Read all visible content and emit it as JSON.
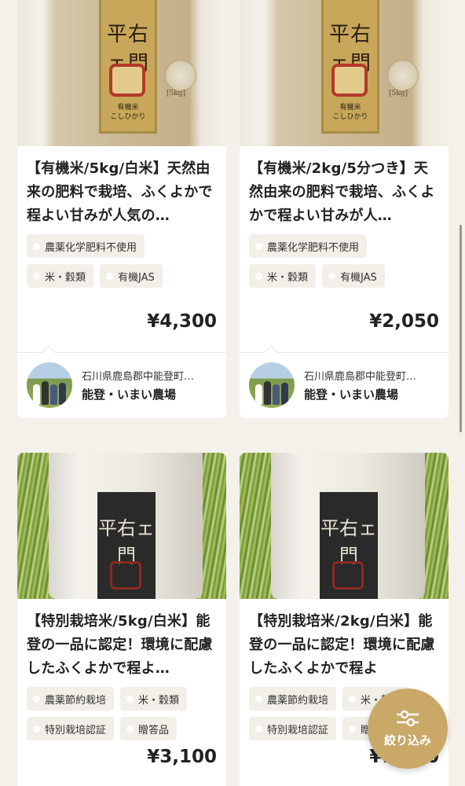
{
  "products": [
    {
      "title": "【有機米/5kg/白米】天然由来の肥料で栽培、ふくよかで程よい甘みが人気の…",
      "tags": [
        "農薬化学肥料不使用",
        "米・穀類",
        "有機JAS"
      ],
      "price": "¥4,300",
      "farm_location": "石川県鹿島郡中能登町…",
      "farm_name": "能登・いまい農場",
      "image": "organic-rice-kraft-bag"
    },
    {
      "title": "【有機米/2kg/5分つき】天然由来の肥料で栽培、ふくよかで程よい甘みが人…",
      "tags": [
        "農薬化学肥料不使用",
        "米・穀類",
        "有機JAS"
      ],
      "price": "¥2,050",
      "farm_location": "石川県鹿島郡中能登町…",
      "farm_name": "能登・いまい農場",
      "image": "organic-rice-kraft-bag"
    },
    {
      "title": "【特別栽培米/5kg/白米】能登の一品に認定！環境に配慮したふくよかで程よ…",
      "tags": [
        "農薬節約栽培",
        "米・穀類",
        "特別栽培認証",
        "贈答品"
      ],
      "price": "¥3,100",
      "image": "special-rice-white-bag-grass"
    },
    {
      "title": "【特別栽培米/2kg/白米】能登の一品に認定！環境に配慮したふくよかで程よ",
      "tags": [
        "農薬節約栽培",
        "米・穀類",
        "特別栽培認証",
        "贈答品"
      ],
      "price": "¥1,650",
      "image": "special-rice-white-bag-grass"
    }
  ],
  "filter_button": {
    "label": "絞り込み",
    "icon": "sliders-icon"
  },
  "colors": {
    "accent": "#c9a868",
    "background": "#f4f1ea",
    "tag_bg": "#f2efe9"
  }
}
